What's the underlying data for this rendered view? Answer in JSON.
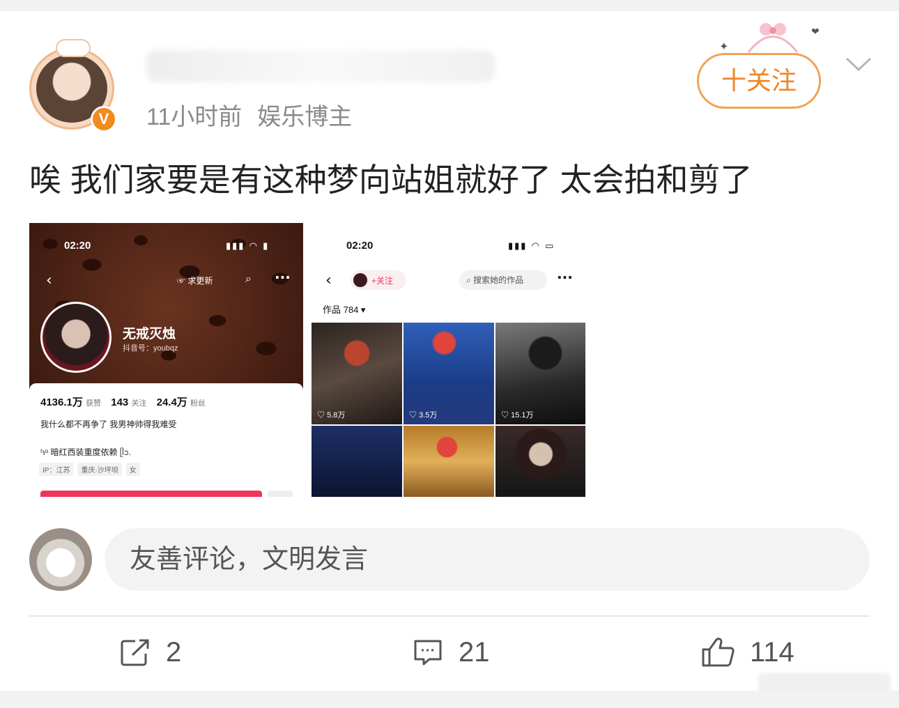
{
  "post": {
    "time": "11小时前",
    "category": "娱乐博主",
    "text": "唉 我们家要是有这种梦向站姐就好了 太会拍和剪了",
    "follow_label": "十关注",
    "verified_badge": "V"
  },
  "screenshot_left": {
    "time": "02:20",
    "request_update": "求更新",
    "name": "无戒灭烛",
    "douyin_id": "抖音号：youbqz",
    "likes_value": "4136.1万",
    "likes_label": "获赞",
    "following_value": "143",
    "following_label": "关注",
    "fans_value": "24.4万",
    "fans_label": "粉丝",
    "bio_line1": "我什么都不再争了 我男神帅得我难受",
    "bio_line2": "ᵗ℩ᵒ 暗红西装重度依赖 ᥫᩣ.",
    "tags": [
      "IP：江苏",
      "重庆·沙坪坝",
      "女"
    ]
  },
  "screenshot_right": {
    "time": "02:20",
    "follow_label": "+关注",
    "search_placeholder": "搜索她的作品",
    "works_label": "作品 784 ▾",
    "likes": [
      "5.8万",
      "3.5万",
      "15.1万"
    ]
  },
  "comment": {
    "placeholder": "友善评论，文明发言"
  },
  "actions": {
    "repost_count": "2",
    "comment_count": "21",
    "like_count": "114"
  },
  "colors": {
    "accent_orange": "#f08524",
    "douyin_red": "#f0335a"
  }
}
